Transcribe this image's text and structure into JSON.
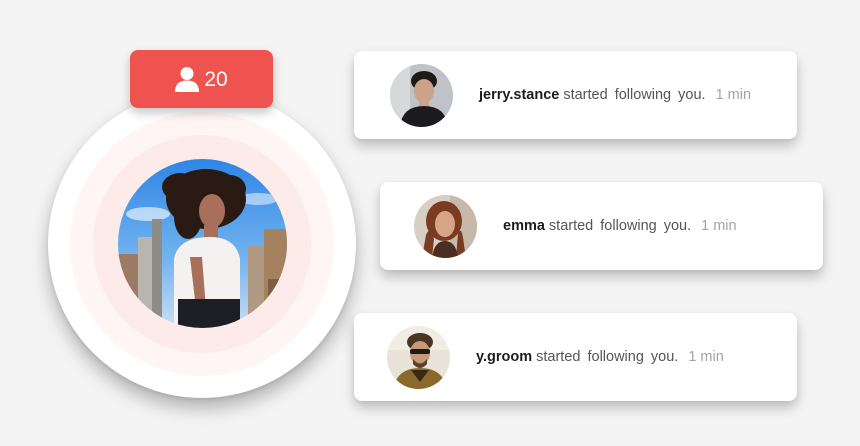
{
  "badge": {
    "icon": "user-icon",
    "count": "20",
    "color": "#ef5350"
  },
  "profile": {
    "avatar": "profile-photo"
  },
  "notifications": [
    {
      "username": "jerry.stance",
      "action": "started  following you.",
      "time": "1 min",
      "avatar": "avatar-jerry"
    },
    {
      "username": "emma",
      "action": "started  following you.",
      "time": "1 min",
      "avatar": "avatar-emma"
    },
    {
      "username": "y.groom",
      "action": "started  following you.",
      "time": "1 min",
      "avatar": "avatar-ygroom"
    }
  ]
}
